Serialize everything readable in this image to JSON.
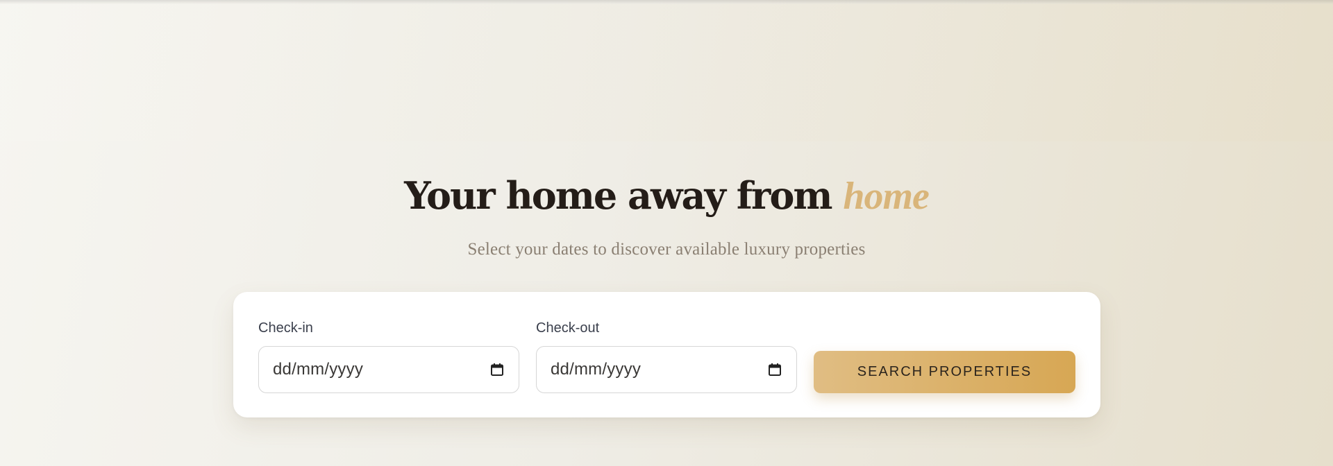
{
  "hero": {
    "title_main": "Your home away from",
    "title_accent": "home",
    "subtitle": "Select your dates to discover available luxury properties"
  },
  "search": {
    "checkin": {
      "label": "Check-in",
      "placeholder": "dd/mm/yyyy",
      "icon": "calendar-icon"
    },
    "checkout": {
      "label": "Check-out",
      "placeholder": "dd/mm/yyyy",
      "icon": "calendar-icon"
    },
    "button_label": "SEARCH PROPERTIES"
  },
  "colors": {
    "accent_gold": "#d9b57a",
    "button_gradient_start": "#e0bd83",
    "button_gradient_end": "#d7a754",
    "headline_text": "#241d18",
    "subtitle_text": "#8a7f72"
  }
}
